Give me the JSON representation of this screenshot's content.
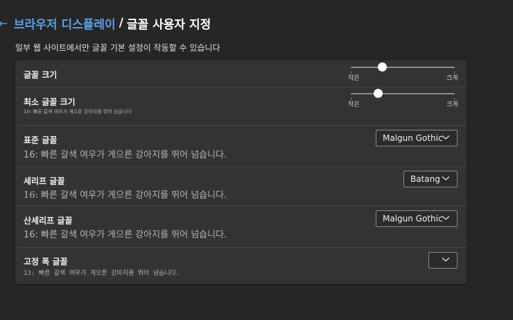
{
  "header": {
    "back_icon": "←",
    "parent": "브라우저 디스플레이",
    "separator": "/",
    "current": "글꼴 사용자 지정"
  },
  "note": "일부 웹 사이트에서만 글꼴 기본 설정이 작동할 수 있습니다",
  "font_size": {
    "title": "글꼴 크기",
    "min_label": "작은",
    "max_label": "크게",
    "level": 0.3
  },
  "min_font_size": {
    "title": "최소 글꼴 크기",
    "sample": "10: 빠른 갈색 여우가 게으른 강아지를 뛰어 넘습니다",
    "min_label": "작은",
    "max_label": "크게",
    "level": 0.26
  },
  "standard_font": {
    "title": "표준 글꼴",
    "sample": "16: 빠른 갈색 여우가 게으른 강아지를 뛰어 넘습니다.",
    "selected": "Malgun Gothic"
  },
  "serif_font": {
    "title": "세리프 글꼴",
    "sample": "16: 빠른 갈색 여우가 게으른 강아지를 뛰어 넘습니다.",
    "selected": "Batang"
  },
  "sans_serif_font": {
    "title": "산세리프 글꼴",
    "sample": "16: 빠른 갈색 여우가 게으른 강아지를 뛰어 넘습니다.",
    "selected": "Malgun Gothic"
  },
  "fixed_width_font": {
    "title": "고정 폭 글꼴",
    "sample": "13: 빠른 갈색 여우가 게으른 강아지를 뛰어 넘습니다.",
    "selected": ""
  },
  "colors": {
    "accent": "#5aa0e6",
    "background": "#262626",
    "card": "#333333"
  }
}
